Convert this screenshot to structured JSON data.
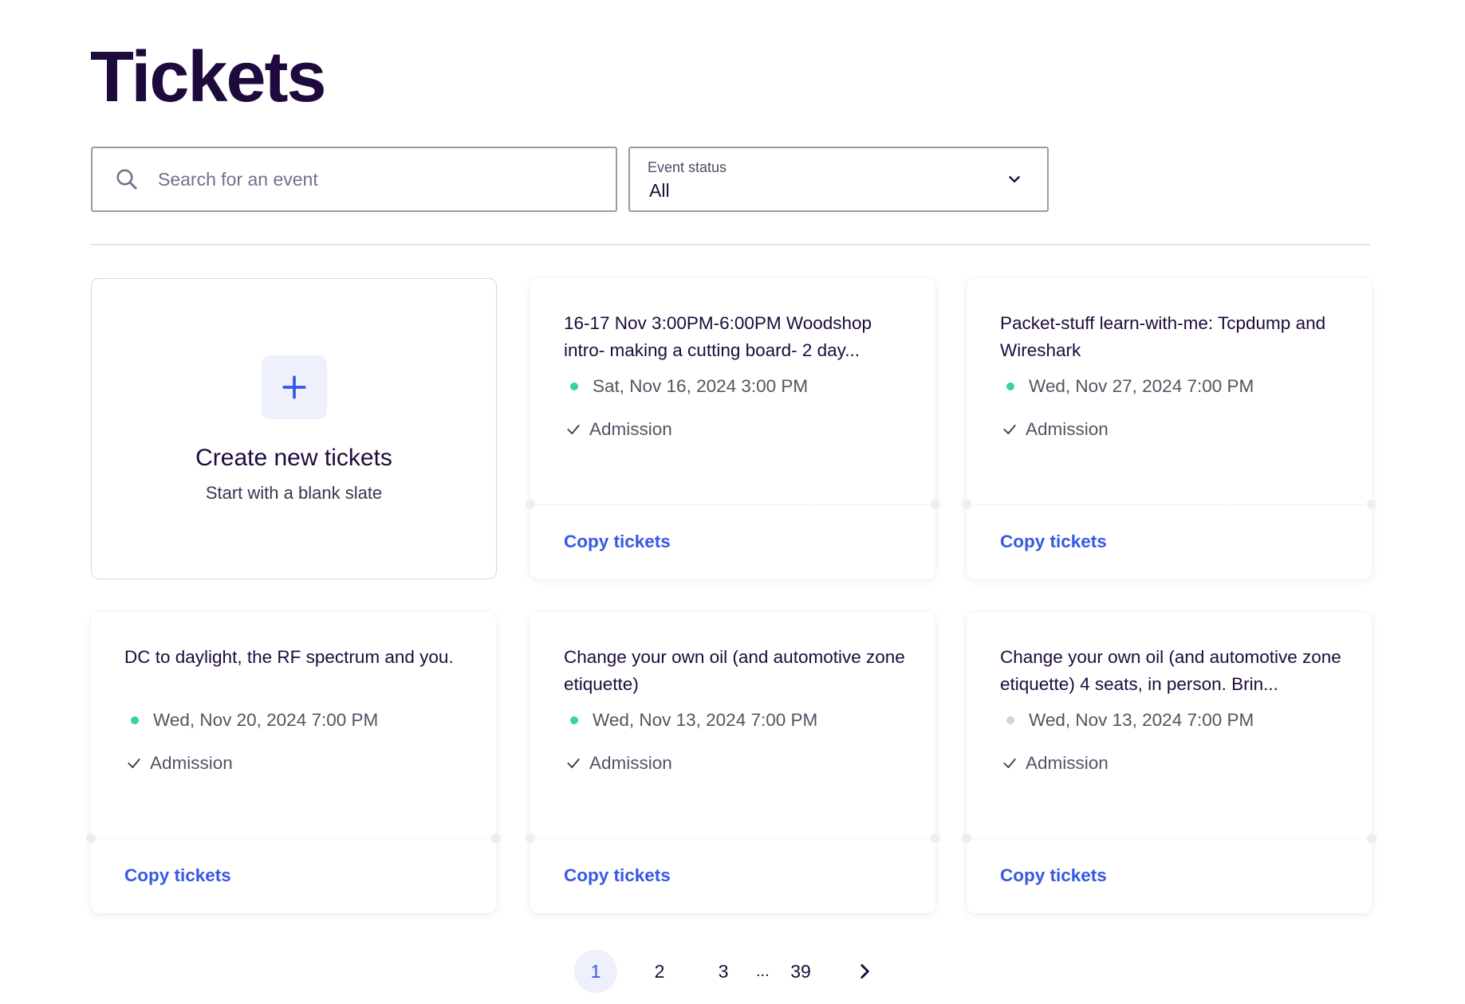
{
  "page": {
    "title": "Tickets"
  },
  "search": {
    "placeholder": "Search for an event",
    "value": ""
  },
  "filter": {
    "label": "Event status",
    "value": "All"
  },
  "create_card": {
    "title": "Create new tickets",
    "subtitle": "Start with a blank slate"
  },
  "events": [
    {
      "title": "16-17 Nov 3:00PM-6:00PM Woodshop intro- making a cutting board- 2 day...",
      "date": "Sat, Nov 16, 2024 3:00 PM",
      "status_color": "#3ad29f",
      "ticket": "Admission",
      "action": "Copy tickets"
    },
    {
      "title": "Packet-stuff learn-with-me: Tcpdump and Wireshark",
      "date": "Wed, Nov 27, 2024 7:00 PM",
      "status_color": "#3ad29f",
      "ticket": "Admission",
      "action": "Copy tickets"
    },
    {
      "title": "DC to daylight, the RF spectrum and you.",
      "date": "Wed, Nov 20, 2024 7:00 PM",
      "status_color": "#3ad29f",
      "ticket": "Admission",
      "action": "Copy tickets"
    },
    {
      "title": "Change your own oil (and automotive zone etiquette)",
      "date": "Wed, Nov 13, 2024 7:00 PM",
      "status_color": "#3ad29f",
      "ticket": "Admission",
      "action": "Copy tickets"
    },
    {
      "title": "Change your own oil (and automotive zone etiquette) 4 seats, in person. Brin...",
      "date": "Wed, Nov 13, 2024 7:00 PM",
      "status_color": "#d4d4d8",
      "ticket": "Admission",
      "action": "Copy tickets"
    }
  ],
  "pagination": {
    "pages": [
      "1",
      "2",
      "3"
    ],
    "ellipsis": "...",
    "last": "39",
    "current": "1"
  },
  "colors": {
    "accent": "#3659e3",
    "active_dot": "#3ad29f",
    "inactive_dot": "#d4d4d8"
  }
}
